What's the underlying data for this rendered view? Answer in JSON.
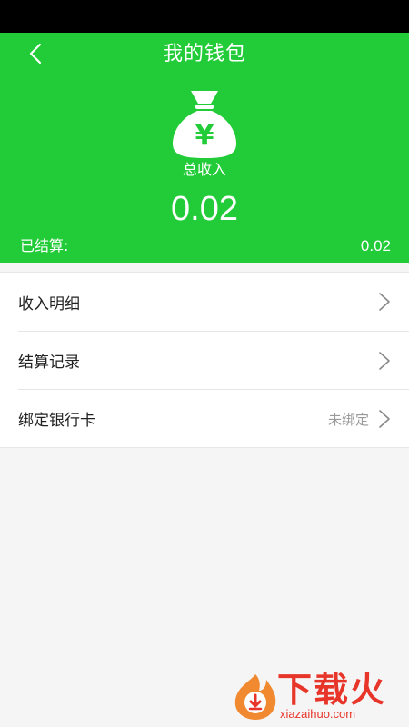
{
  "header": {
    "title": "我的钱包",
    "back_icon": "chevron-left-icon",
    "bag_icon": "money-bag-yen-icon",
    "bag_symbol": "¥",
    "total_label": "总收入",
    "total_value": "0.02",
    "settled_label": "已结算:",
    "settled_value": "0.02",
    "color": "#22cc38"
  },
  "list": {
    "items": [
      {
        "label": "收入明细",
        "value": ""
      },
      {
        "label": "结算记录",
        "value": ""
      },
      {
        "label": "绑定银行卡",
        "value": "未绑定"
      }
    ]
  },
  "watermark": {
    "text": "下载火",
    "url": "xiazaihuo.com",
    "color": "#e8352a"
  }
}
